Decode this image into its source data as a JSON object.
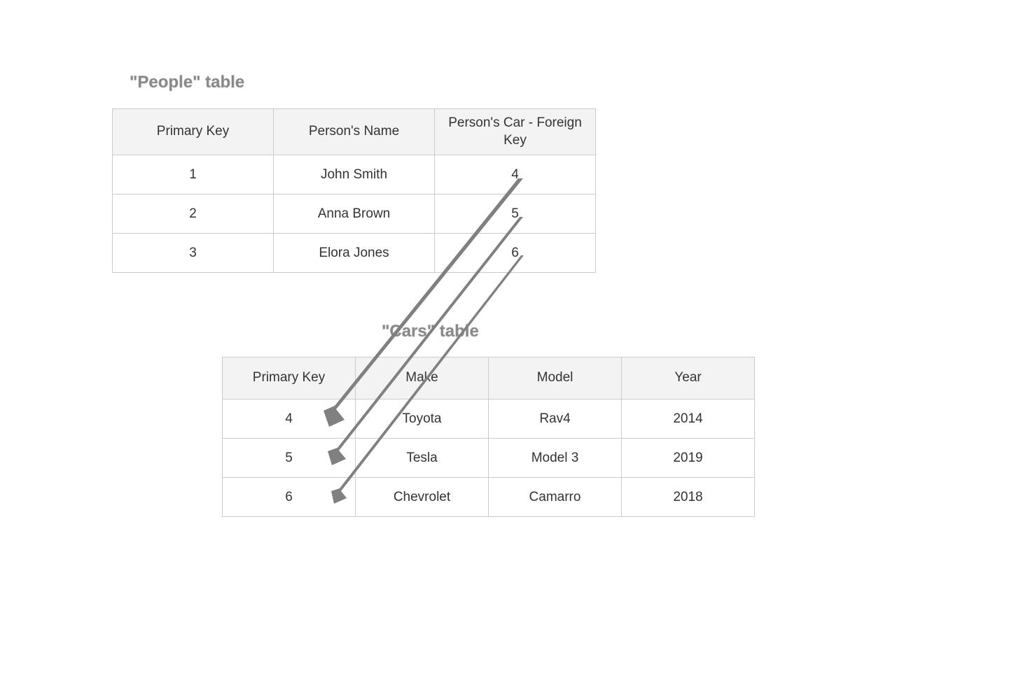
{
  "titles": {
    "people": "\"People\" table",
    "cars": "\"Cars\" table"
  },
  "people_table": {
    "headers": {
      "pk": "Primary Key",
      "name": "Person's Name",
      "fk": "Person's Car - Foreign Key"
    },
    "rows": [
      {
        "pk": "1",
        "name": "John Smith",
        "fk": "4"
      },
      {
        "pk": "2",
        "name": "Anna Brown",
        "fk": "5"
      },
      {
        "pk": "3",
        "name": "Elora Jones",
        "fk": "6"
      }
    ]
  },
  "cars_table": {
    "headers": {
      "pk": "Primary Key",
      "make": "Make",
      "model": "Model",
      "year": "Year"
    },
    "rows": [
      {
        "pk": "4",
        "make": "Toyota",
        "model": "Rav4",
        "year": "2014"
      },
      {
        "pk": "5",
        "make": "Tesla",
        "model": "Model 3",
        "year": "2019"
      },
      {
        "pk": "6",
        "make": "Chevrolet",
        "model": "Camarro",
        "year": "2018"
      }
    ]
  }
}
